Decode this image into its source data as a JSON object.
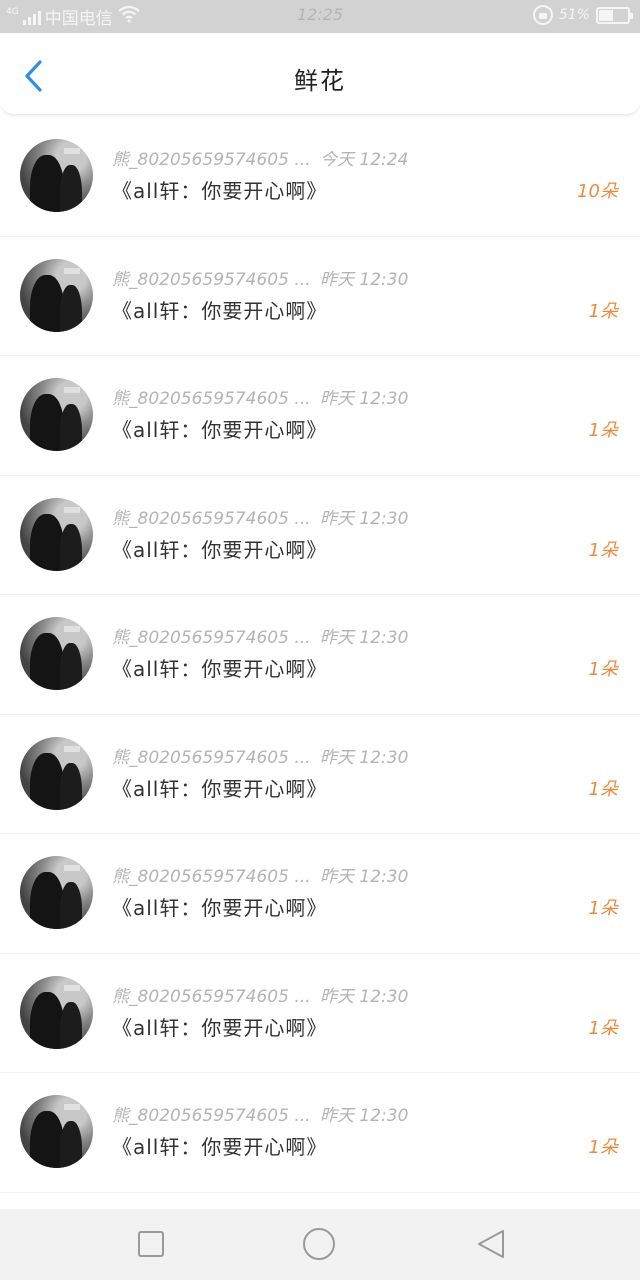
{
  "status_bar": {
    "network": "4G",
    "carrier": "中国电信",
    "time": "12:25",
    "battery_percent": "51%",
    "battery_level": 0.51
  },
  "nav": {
    "title": "鲜花",
    "back_icon": "chevron-left-icon",
    "accent_color": "#2f8ee6"
  },
  "items": [
    {
      "name": "熊_80205659574605 ...",
      "time": "今天 12:24",
      "message": "《all轩：你要开心啊》",
      "count": "10朵"
    },
    {
      "name": "熊_80205659574605 ...",
      "time": "昨天 12:30",
      "message": "《all轩：你要开心啊》",
      "count": "1朵"
    },
    {
      "name": "熊_80205659574605 ...",
      "time": "昨天 12:30",
      "message": "《all轩：你要开心啊》",
      "count": "1朵"
    },
    {
      "name": "熊_80205659574605 ...",
      "time": "昨天 12:30",
      "message": "《all轩：你要开心啊》",
      "count": "1朵"
    },
    {
      "name": "熊_80205659574605 ...",
      "time": "昨天 12:30",
      "message": "《all轩：你要开心啊》",
      "count": "1朵"
    },
    {
      "name": "熊_80205659574605 ...",
      "time": "昨天 12:30",
      "message": "《all轩：你要开心啊》",
      "count": "1朵"
    },
    {
      "name": "熊_80205659574605 ...",
      "time": "昨天 12:30",
      "message": "《all轩：你要开心啊》",
      "count": "1朵"
    },
    {
      "name": "熊_80205659574605 ...",
      "time": "昨天 12:30",
      "message": "《all轩：你要开心啊》",
      "count": "1朵"
    },
    {
      "name": "熊_80205659574605 ...",
      "time": "昨天 12:30",
      "message": "《all轩：你要开心啊》",
      "count": "1朵"
    }
  ],
  "colors": {
    "count_color": "#ee8a3c",
    "meta_color": "#b4b4b4"
  },
  "system_nav": {
    "recents_icon": "square-icon",
    "home_icon": "circle-icon",
    "back_icon": "triangle-back-icon"
  }
}
